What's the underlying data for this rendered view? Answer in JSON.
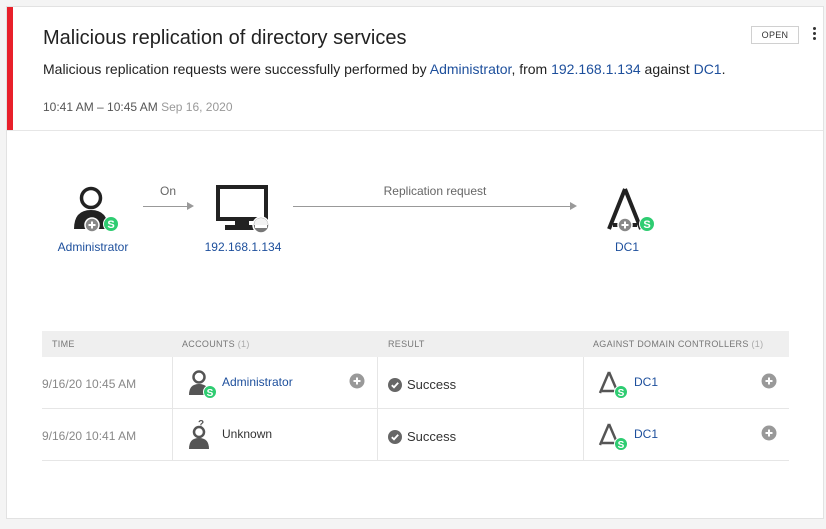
{
  "alert": {
    "title": "Malicious replication of directory services",
    "desc_prefix": "Malicious replication requests were successfully performed by ",
    "desc_account": "Administrator",
    "desc_mid1": ", from ",
    "desc_ip": "192.168.1.134",
    "desc_mid2": " against ",
    "desc_dc": "DC1",
    "desc_suffix": ".",
    "time_range": "10:41 AM – 10:45 AM",
    "date": "Sep 16, 2020",
    "status_button": "OPEN",
    "accent_color": "#e8202a"
  },
  "flow": {
    "source": "Administrator",
    "edge1_label": "On",
    "device": "192.168.1.134",
    "edge2_label": "Replication request",
    "target": "DC1",
    "badge_letter": "S",
    "badge_color": "#2ecc71",
    "link_color": "#1d4f9c"
  },
  "table": {
    "headers": {
      "time": "TIME",
      "accounts": "ACCOUNTS",
      "accounts_count": "(1)",
      "result": "RESULT",
      "dcs": "AGAINST DOMAIN CONTROLLERS",
      "dcs_count": "(1)"
    },
    "rows": [
      {
        "time": "9/16/20 10:45 AM",
        "account": "Administrator",
        "result": "Success",
        "dc": "DC1"
      },
      {
        "time": "9/16/20 10:41 AM",
        "account": "Unknown",
        "result": "Success",
        "dc": "DC1"
      }
    ]
  },
  "icons": {
    "user": "user-icon",
    "sensitive_badge": "sensitive-s-badge-icon",
    "computer": "computer-icon",
    "domain_controller": "domain-controller-icon",
    "check": "check-circle-icon",
    "plus": "plus-circle-icon",
    "unknown_user": "unknown-user-icon",
    "more": "more-vertical-icon"
  }
}
